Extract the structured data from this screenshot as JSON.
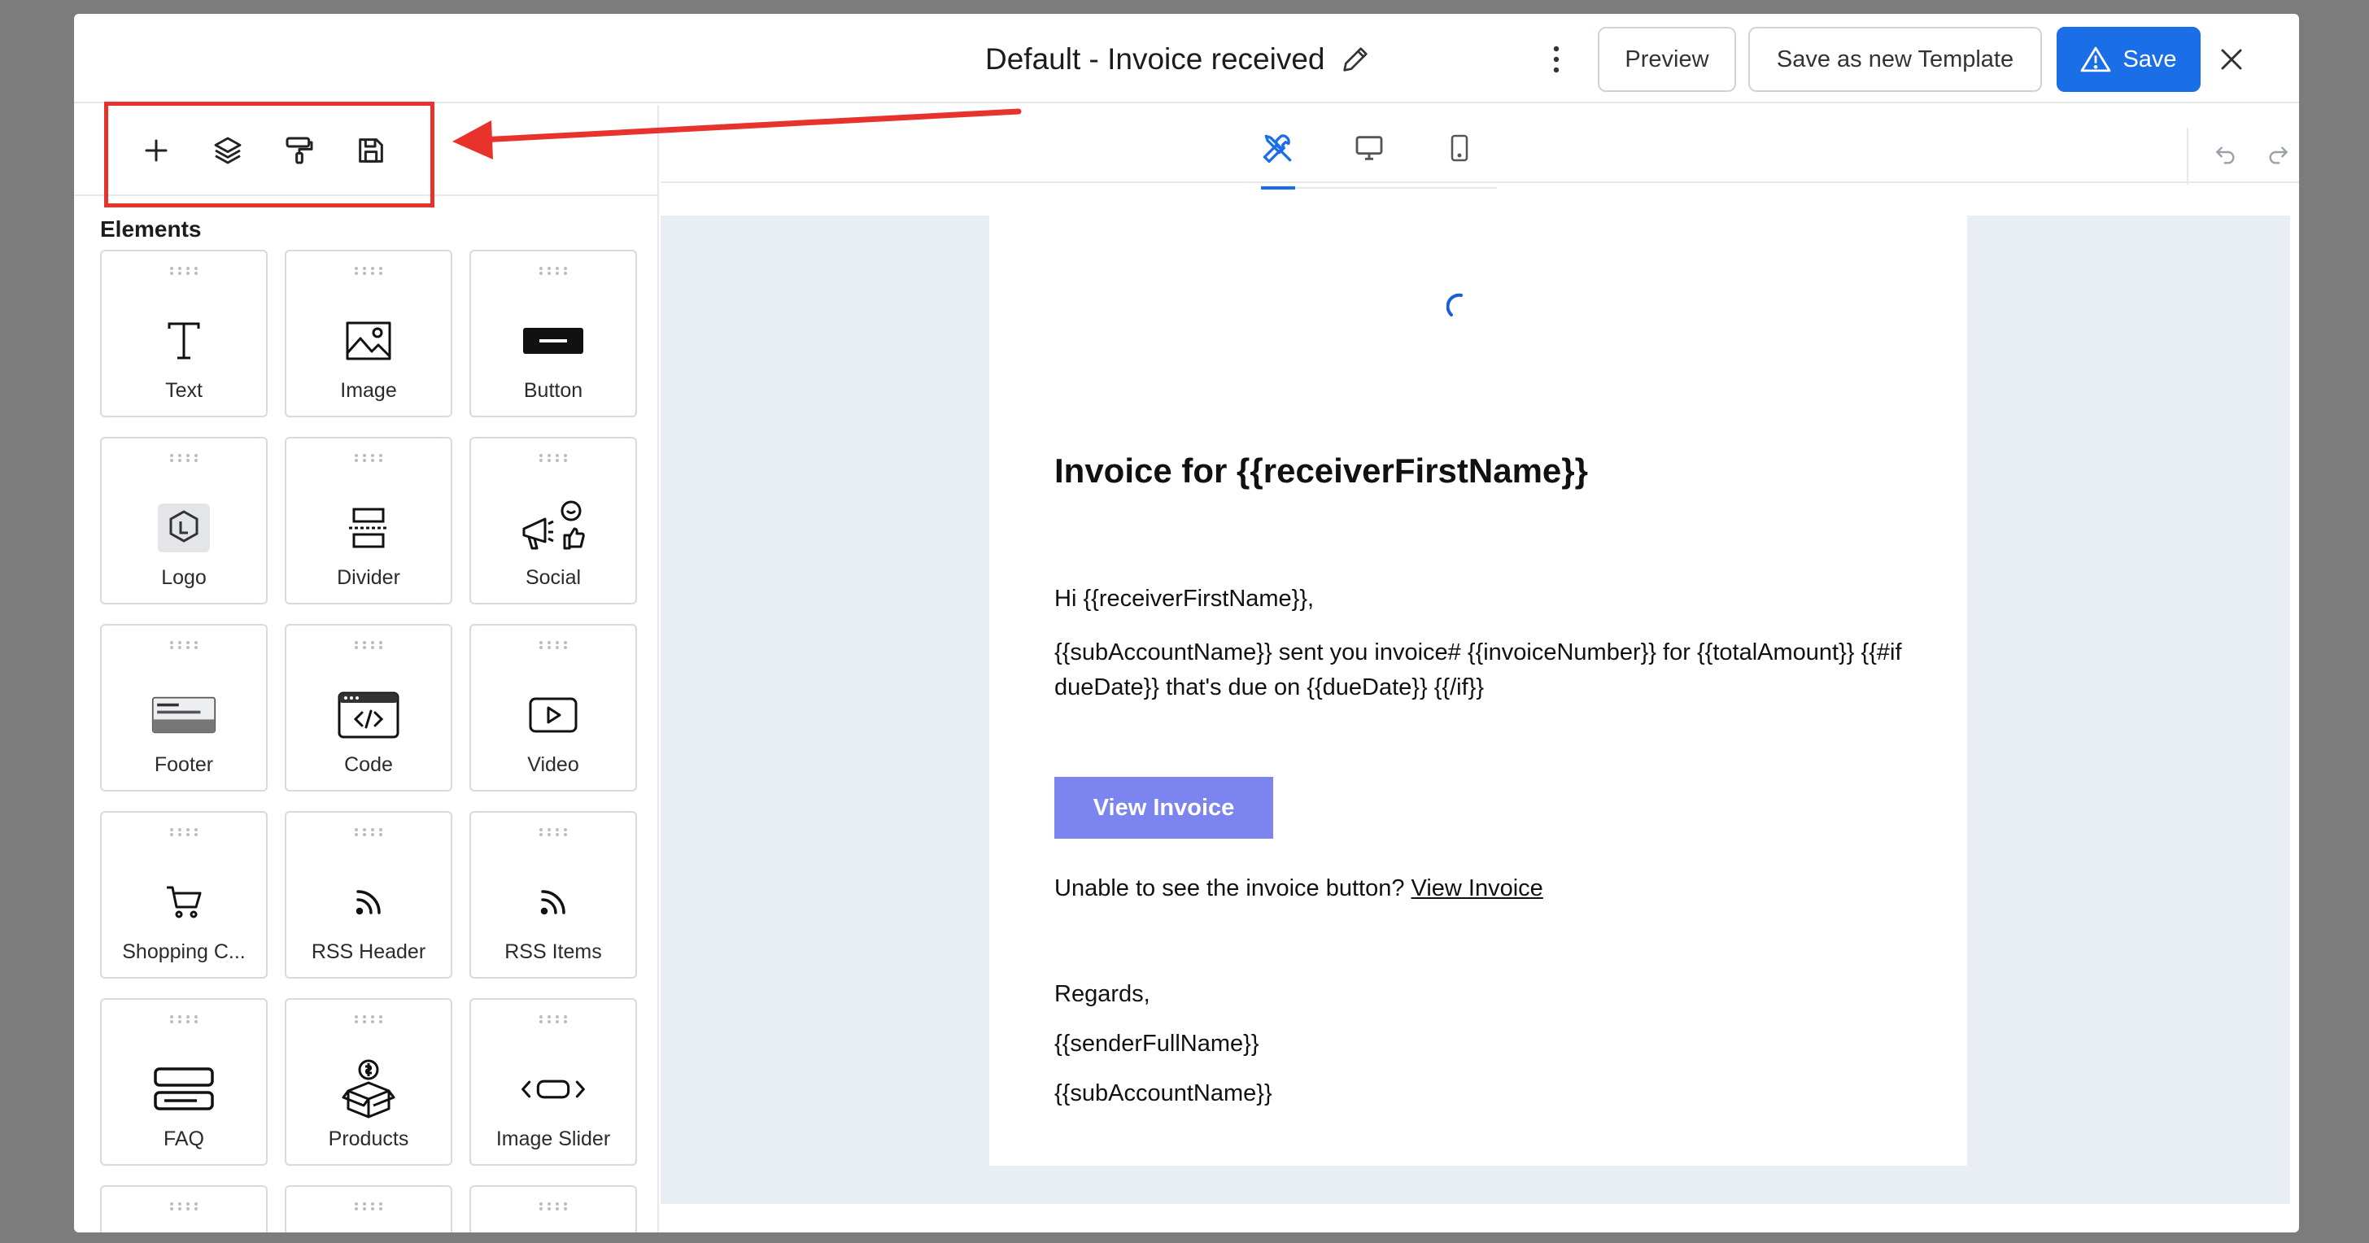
{
  "header": {
    "title": "Default - Invoice received",
    "preview_label": "Preview",
    "save_template_label": "Save as new Template",
    "save_label": "Save"
  },
  "sidebar": {
    "elements_heading": "Elements",
    "items": [
      {
        "label": "Text",
        "icon": "text-icon"
      },
      {
        "label": "Image",
        "icon": "image-icon"
      },
      {
        "label": "Button",
        "icon": "button-icon"
      },
      {
        "label": "Logo",
        "icon": "logo-icon"
      },
      {
        "label": "Divider",
        "icon": "divider-icon"
      },
      {
        "label": "Social",
        "icon": "social-icon"
      },
      {
        "label": "Footer",
        "icon": "footer-icon"
      },
      {
        "label": "Code",
        "icon": "code-icon"
      },
      {
        "label": "Video",
        "icon": "video-icon"
      },
      {
        "label": "Shopping C...",
        "icon": "cart-icon"
      },
      {
        "label": "RSS Header",
        "icon": "rss-icon"
      },
      {
        "label": "RSS Items",
        "icon": "rss-icon"
      },
      {
        "label": "FAQ",
        "icon": "faq-icon"
      },
      {
        "label": "Products",
        "icon": "products-icon"
      },
      {
        "label": "Image Slider",
        "icon": "slider-icon"
      }
    ]
  },
  "email": {
    "heading": "Invoice for {{receiverFirstName}}",
    "greeting": "Hi {{receiverFirstName}},",
    "body": "{{subAccountName}} sent you invoice# {{invoiceNumber}} for {{totalAmount}} {{#if dueDate}} that's due on {{dueDate}} {{/if}}",
    "cta_label": "View Invoice",
    "fallback_text": "Unable to see the invoice button? ",
    "fallback_link": "View Invoice",
    "regards": "Regards,",
    "sender": "{{senderFullName}}",
    "account": "{{subAccountName}}"
  },
  "colors": {
    "primary": "#1a6ee8",
    "cta": "#7c84ef",
    "annotation": "#e8322c",
    "canvas_bg": "#e9eef5"
  }
}
